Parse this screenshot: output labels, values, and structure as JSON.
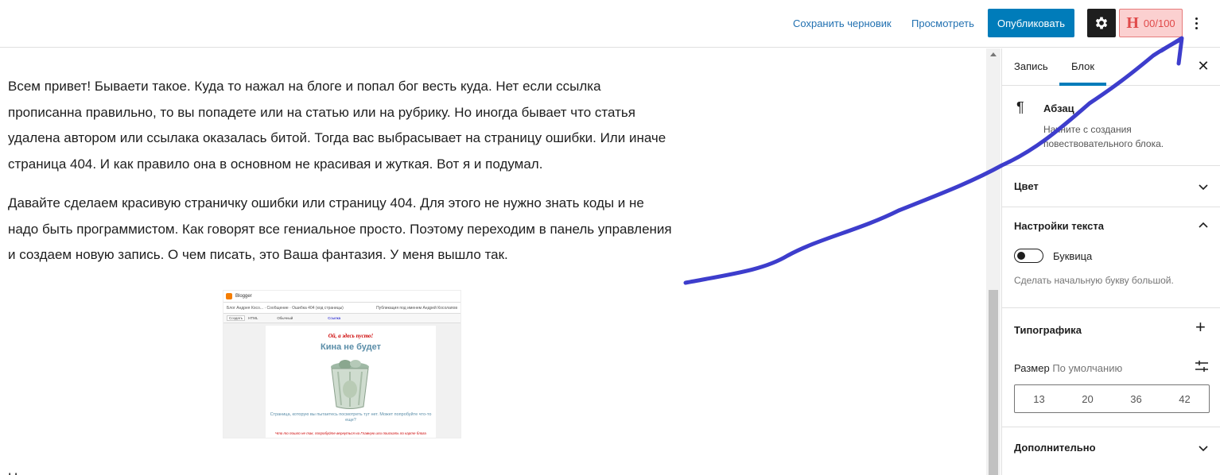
{
  "topbar": {
    "save_draft": "Сохранить черновик",
    "preview": "Просмотреть",
    "publish": "Опубликовать",
    "seo_letter": "H",
    "seo_score": "00/100"
  },
  "content": {
    "paragraph1": "Всем привет! Бываети такое. Куда то нажал на блоге и попал бог весть куда. Нет если ссылка прописанна правильно, то вы попадете или на статью или на рубрику. Но иногда бывает что статья удалена автором или ссылака оказалась битой. Тогда вас выбрасывает на страницу ошибки. Или иначе страница 404. И как правило она в основном не красивая и жуткая. Вот я и подумал.",
    "paragraph2": "Давайте сделаем красивую страничку ошибки или страницу 404. Для этого не нужно знать коды и не надо быть программистом. Как говорят все гениальное просто. Поэтому переходим в панель управления и создаем новую запись. О чем писать, это Ваша фантазия. У меня вышло так.",
    "image": {
      "app": "Blogger",
      "breadcrumb": "Блог Андрея Косо... · Сообщение · Ошибка 404 (код страницы)",
      "user": "Публикация под именем Андрей Косолапов",
      "btn_create": "Создать",
      "btn_html": "HTML",
      "font": "Обычный",
      "link": "Ссылка",
      "heading_small": "Ой, а здесь пусто!",
      "heading_big": "Кина не будет",
      "caption": "Страница, которую вы пытаетесь посмотреть тут нет. Может попробуйте что-то еще?",
      "footer": "Что то пошло не так, попробуйте вернуться на Главную или поискать по карте блога"
    },
    "paragraph3": "Н..."
  },
  "sidebar": {
    "tab_post": "Запись",
    "tab_block": "Блок",
    "block_icon": "paragraph-icon",
    "block_title": "Абзац",
    "block_desc": "Начните с создания повествовательного блока.",
    "panel_color": "Цвет",
    "panel_text": "Настройки текста",
    "dropcap_label": "Буквица",
    "dropcap_help": "Сделать начальную букву большой.",
    "dropcap_on": false,
    "panel_typography": "Типографика",
    "size_label": "Размер",
    "size_default": "По умолчанию",
    "sizes": [
      "13",
      "20",
      "36",
      "42"
    ],
    "panel_advanced": "Дополнительно"
  },
  "colors": {
    "publish": "#007cba",
    "link": "#2271b1",
    "seo_bg": "#fbd0d0",
    "seo_text": "#e04a4a",
    "annotation": "#3d3dcc"
  }
}
